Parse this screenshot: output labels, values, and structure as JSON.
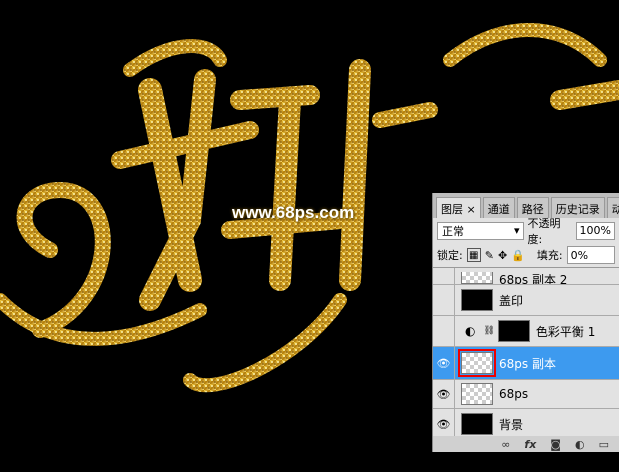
{
  "watermark": "www.68ps.com",
  "panel": {
    "tabs": [
      {
        "label": "图层 ×"
      },
      {
        "label": "通道"
      },
      {
        "label": "路径"
      },
      {
        "label": "历史记录"
      },
      {
        "label": "动"
      }
    ],
    "blend_mode": "正常",
    "opacity_label": "不透明度:",
    "opacity": "100%",
    "lock_label": "锁定:",
    "fill_label": "填充:",
    "fill": "0%",
    "layers": [
      {
        "name": "68ps 副本 2",
        "visible": false
      },
      {
        "name": "盖印",
        "visible": false
      },
      {
        "name": "色彩平衡 1",
        "visible": false
      },
      {
        "name": "68ps 副本",
        "visible": true,
        "selected": true
      },
      {
        "name": "68ps",
        "visible": true
      },
      {
        "name": "背景",
        "visible": true
      }
    ],
    "footer_icons": [
      "link-icon",
      "fx-icon",
      "mask-icon",
      "adjustment-icon",
      "folder-icon"
    ],
    "footer_fx": "fx"
  },
  "colors": {
    "gold": "#d9a81a",
    "selection": "#3d9aef"
  }
}
